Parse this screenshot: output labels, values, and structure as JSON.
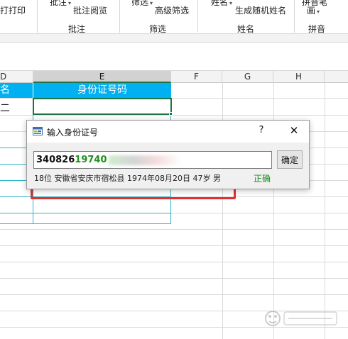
{
  "ribbon": {
    "top_items": [
      {
        "id": "print",
        "label": "打打印"
      },
      {
        "id": "annotate",
        "label": "批注"
      },
      {
        "id": "annotate-browse",
        "label": "批注阅览"
      },
      {
        "id": "filter",
        "label": "筛选"
      },
      {
        "id": "adv-filter",
        "label": "高级筛选"
      },
      {
        "id": "name",
        "label": "姓名"
      },
      {
        "id": "random-name",
        "label": "生成随机姓名"
      },
      {
        "id": "pinyin-strokes",
        "label": "拼音笔"
      },
      {
        "id": "pinyin-strokes-2",
        "label": "画"
      }
    ],
    "groups": [
      "批注",
      "筛选",
      "姓名",
      "拼音"
    ]
  },
  "sheet": {
    "columns": [
      "D",
      "E",
      "F",
      "G",
      "H"
    ],
    "selected_column": "E",
    "header_cells": {
      "d": "名",
      "e": "身份证号码"
    },
    "row1_d": "二"
  },
  "dialog": {
    "title": "输入身份证号",
    "help": "?",
    "close": "✕",
    "id_black": "340826",
    "id_green": "19740",
    "ok_label": "确定",
    "info": "18位  安徽省安庆市宿松县  1974年08月20日  47岁  男",
    "status": "正确"
  },
  "colors": {
    "header_fill": "#00b0f0",
    "table_border": "#2fb3c9",
    "annotation": "#e03030",
    "valid_green": "#1a8a1a"
  }
}
